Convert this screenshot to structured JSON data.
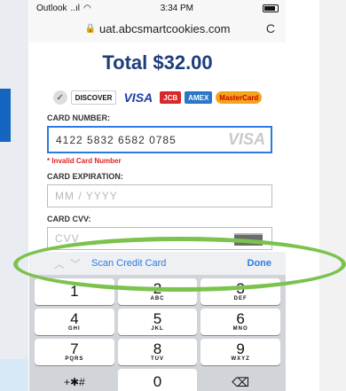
{
  "statusbar": {
    "app": "Outlook",
    "signal": "..ıl",
    "wifi": "◠",
    "time": "3:34 PM"
  },
  "url": {
    "domain": "uat.abcsmartcookies.com",
    "reload": "C"
  },
  "total": "Total $32.00",
  "cards": {
    "discover": "DISCOVER",
    "visa": "VISA",
    "jcb": "JCB",
    "amex": "AMEX",
    "mastercard": "MasterCard"
  },
  "card_number": {
    "label": "CARD NUMBER:",
    "value": "4122 5832 6582 0785",
    "brand": "VISA",
    "error": "* Invalid Card Number"
  },
  "card_expiration": {
    "label": "CARD EXPIRATION:",
    "placeholder": "MM / YYYY"
  },
  "card_cvv": {
    "label": "CARD CVV:",
    "placeholder": "CVV"
  },
  "accessory": {
    "up": "︿",
    "down": "﹀",
    "scan": "Scan Credit Card",
    "done": "Done"
  },
  "keypad": [
    {
      "num": "1",
      "letters": ""
    },
    {
      "num": "2",
      "letters": "ABC"
    },
    {
      "num": "3",
      "letters": "DEF"
    },
    {
      "num": "4",
      "letters": "GHI"
    },
    {
      "num": "5",
      "letters": "JKL"
    },
    {
      "num": "6",
      "letters": "MNO"
    },
    {
      "num": "7",
      "letters": "PQRS"
    },
    {
      "num": "8",
      "letters": "TUV"
    },
    {
      "num": "9",
      "letters": "WXYZ"
    },
    {
      "num": "+✱#",
      "letters": ""
    },
    {
      "num": "0",
      "letters": ""
    },
    {
      "num": "⌫",
      "letters": ""
    }
  ],
  "colors": {
    "accent": "#2a7be0",
    "total": "#1c3d7a",
    "error": "#dd2222",
    "highlight": "#7cc24f"
  }
}
